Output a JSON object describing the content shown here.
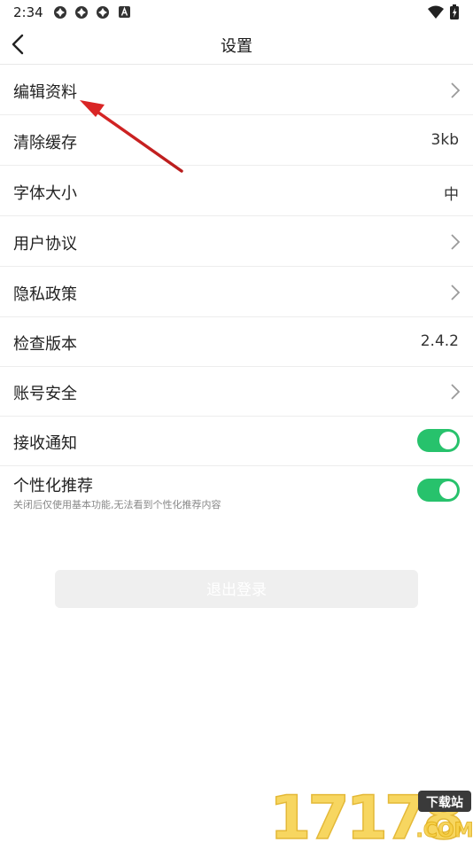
{
  "status_bar": {
    "time": "2:34",
    "notification_icons": [
      "clover-icon",
      "clover-icon",
      "clover-icon",
      "a-badge-icon"
    ],
    "wifi_icon": "wifi-icon",
    "battery_icon": "battery-charging-icon"
  },
  "nav": {
    "back_icon": "chevron-left-icon",
    "title": "设置"
  },
  "settings": {
    "items": [
      {
        "label": "编辑资料",
        "type": "chevron"
      },
      {
        "label": "清除缓存",
        "value": "3kb"
      },
      {
        "label": "字体大小",
        "value": "中"
      },
      {
        "label": "用户协议",
        "type": "chevron"
      },
      {
        "label": "隐私政策",
        "type": "chevron"
      },
      {
        "label": "检查版本",
        "value": "2.4.2"
      },
      {
        "label": "账号安全",
        "type": "chevron"
      },
      {
        "label": "接收通知",
        "type": "toggle",
        "on": true
      },
      {
        "label": "个性化推荐",
        "type": "toggle",
        "on": true,
        "description": "关闭后仅使用基本功能,无法看到个性化推荐内容"
      }
    ]
  },
  "logout_label": "退出登录",
  "watermark": {
    "digits": "17178",
    "badge": "下载站",
    "suffix": ".COM"
  },
  "colors": {
    "toggle_on": "#27c26c",
    "annotation_arrow": "#d92525",
    "logout_bg": "#efefef"
  }
}
